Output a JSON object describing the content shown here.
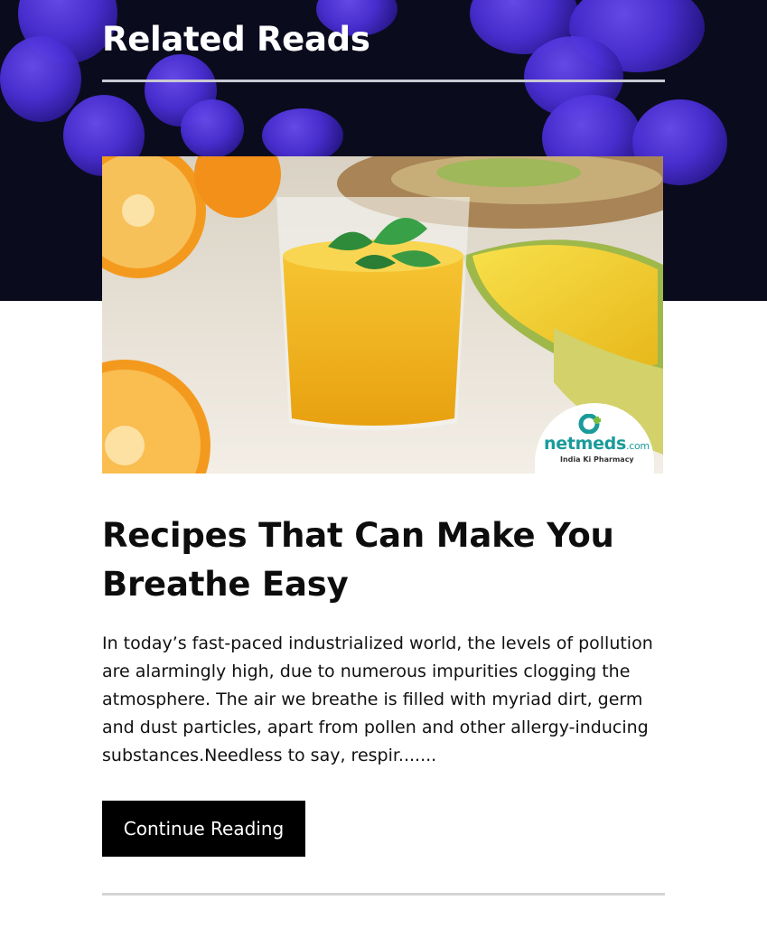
{
  "related": {
    "heading": "Related Reads"
  },
  "article": {
    "image_alt": "Mango smoothie in glass with orange halves and mango",
    "logo": {
      "brand": "netmeds",
      "suffix": ".com",
      "tagline": "India Ki Pharmacy"
    },
    "title": "Recipes That Can Make You Breathe Easy",
    "excerpt": "In today’s fast-paced industrialized world, the levels of pollution are alarmingly high, due to numerous impurities clogging the atmosphere. The air we breathe is filled with myriad dirt, germ and dust particles, apart from pollen and other allergy-inducing substances.Needless to say, respir.......",
    "cta_label": "Continue Reading"
  },
  "colors": {
    "banner_bg": "#0b0b1e",
    "blob": "#4a2fd6",
    "button_bg": "#000000",
    "logo_teal": "#1a9b9a"
  }
}
